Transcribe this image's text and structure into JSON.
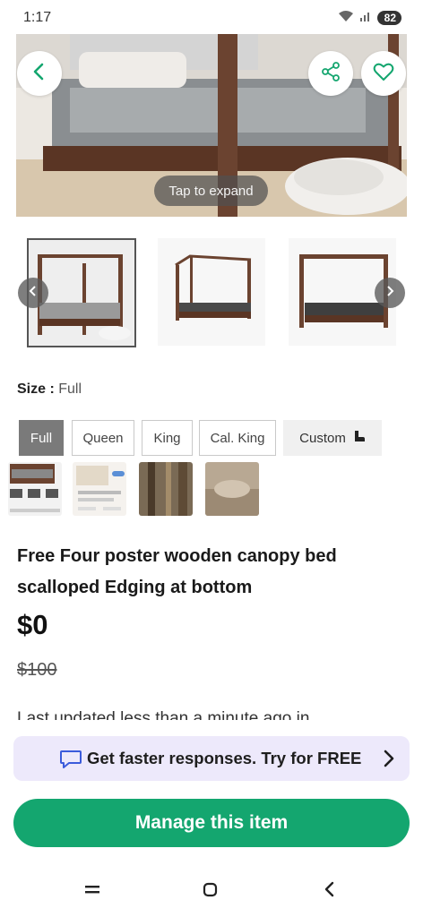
{
  "status_bar": {
    "time": "1:17",
    "battery": "82"
  },
  "hero": {
    "tap_to_expand": "Tap to expand"
  },
  "size": {
    "key": "Size :",
    "value": "Full"
  },
  "size_options": [
    {
      "label": "Full",
      "active": true
    },
    {
      "label": "Queen",
      "active": false
    },
    {
      "label": "King",
      "active": false
    },
    {
      "label": "Cal. King",
      "active": false
    },
    {
      "label": "Custom",
      "active": false
    }
  ],
  "listing": {
    "title": "Free Four poster wooden canopy bed scalloped Edging at bottom",
    "price": "$0",
    "original_price": "$100",
    "last_updated": "Last updated less than a minute ago in"
  },
  "promo": {
    "text": "Get faster responses. Try for FREE"
  },
  "primary_action": {
    "label": "Manage this item"
  },
  "colors": {
    "accent": "#14a66f",
    "promo_bg": "#ede9fb",
    "active_size": "#7a7a7a"
  }
}
